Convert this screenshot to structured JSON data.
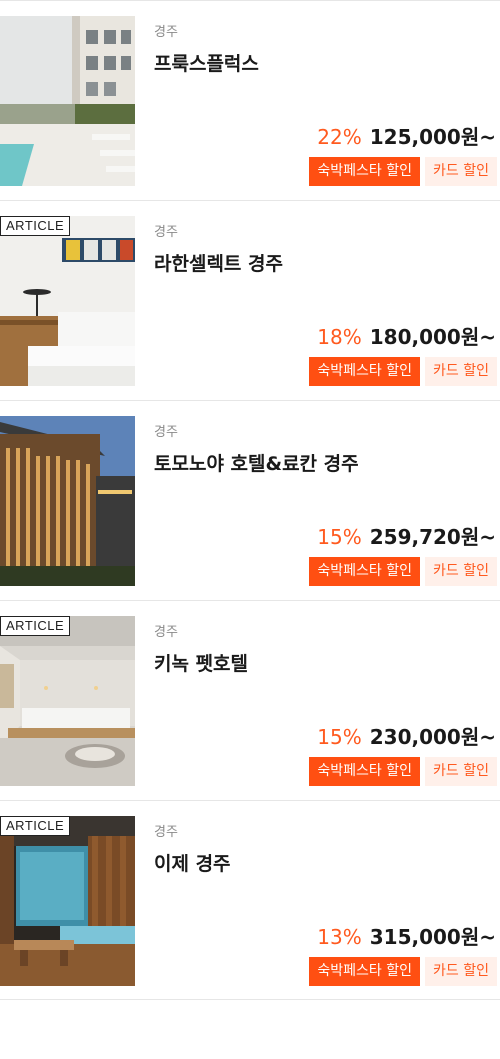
{
  "listings": [
    {
      "region": "경주",
      "name": "프룩스플럭스",
      "discount": "22%",
      "price": "125,000원~",
      "article_tag": "",
      "badges": [
        "숙박페스타 할인",
        "카드 할인"
      ],
      "image_icon": "hotel-pool-photo"
    },
    {
      "region": "경주",
      "name": "라한셀렉트 경주",
      "discount": "18%",
      "price": "180,000원~",
      "article_tag": "ARTICLE",
      "badges": [
        "숙박페스타 할인",
        "카드 할인"
      ],
      "image_icon": "hotel-bedroom-photo"
    },
    {
      "region": "경주",
      "name": "토모노야 호텔&료칸 경주",
      "discount": "15%",
      "price": "259,720원~",
      "article_tag": "",
      "badges": [
        "숙박페스타 할인",
        "카드 할인"
      ],
      "image_icon": "ryokan-exterior-photo"
    },
    {
      "region": "경주",
      "name": "키녹 펫호텔",
      "discount": "15%",
      "price": "230,000원~",
      "article_tag": "ARTICLE",
      "badges": [
        "숙박페스타 할인",
        "카드 할인"
      ],
      "image_icon": "pet-hotel-room-photo"
    },
    {
      "region": "경주",
      "name": "이제 경주",
      "discount": "13%",
      "price": "315,000원~",
      "article_tag": "ARTICLE",
      "badges": [
        "숙박페스타 할인",
        "카드 할인"
      ],
      "image_icon": "indoor-bath-photo"
    }
  ],
  "colors": {
    "accent": "#ff4f12",
    "discount_text": "#ff5a1f",
    "card_badge_bg": "#fff0ea"
  }
}
